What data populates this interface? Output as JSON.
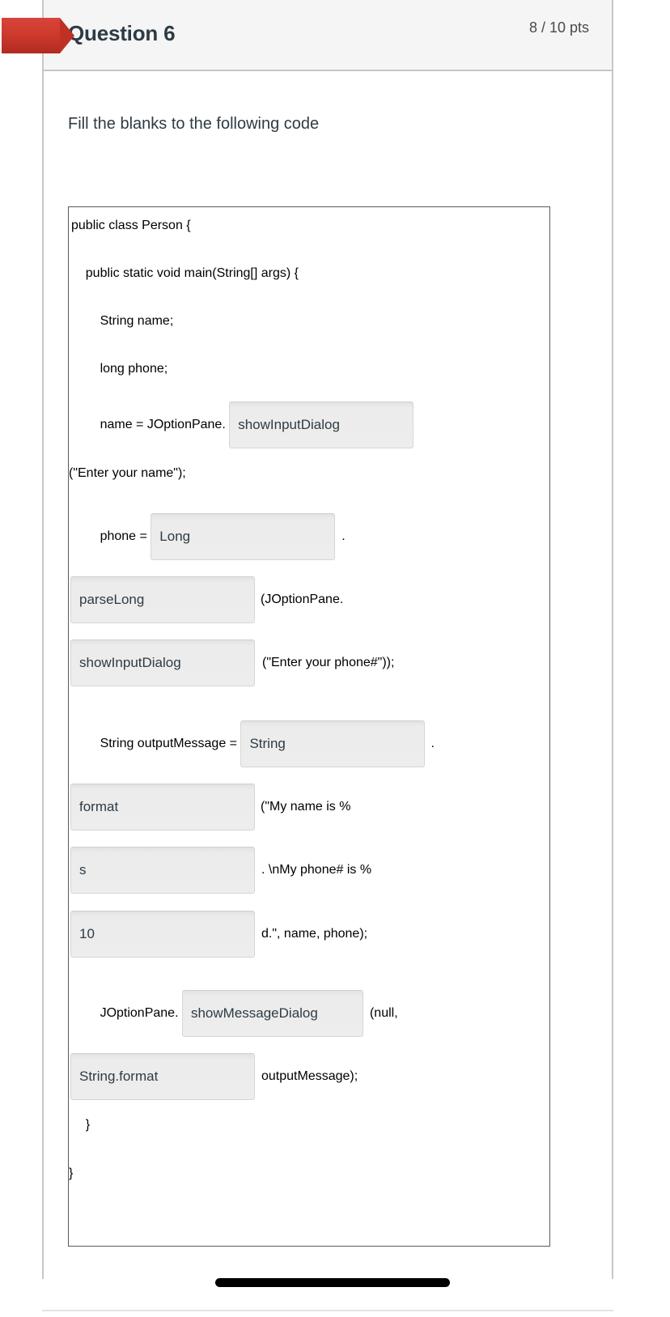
{
  "header": {
    "title": "Question 6",
    "points": "8 / 10 pts",
    "flag_icon": "red-flag-marker"
  },
  "body": {
    "prompt": "Fill the blanks to the following code"
  },
  "code": {
    "lines": [
      {
        "id": "l1",
        "text": "public class Person {"
      },
      {
        "id": "l2",
        "text": "    public static void main(String[] args) {"
      },
      {
        "id": "l3",
        "text": "        String name;"
      },
      {
        "id": "l4",
        "text": "        long phone;"
      },
      {
        "id": "l5",
        "text": "        name = JOptionPane. "
      },
      {
        "id": "l6",
        "text": "(\"Enter your name\");"
      },
      {
        "id": "l7",
        "text": "        phone = "
      },
      {
        "id": "l8",
        "text": "."
      },
      {
        "id": "l9",
        "text": "(JOptionPane."
      },
      {
        "id": "l10",
        "text": "(\"Enter your phone#\"));"
      },
      {
        "id": "l11",
        "text": "        String outputMessage = "
      },
      {
        "id": "l12",
        "text": "."
      },
      {
        "id": "l13",
        "text": "(\"My name is %"
      },
      {
        "id": "l14",
        "text": ". \\nMy phone# is %"
      },
      {
        "id": "l15",
        "text": "d.\", name, phone);"
      },
      {
        "id": "l16",
        "text": "        JOptionPane. "
      },
      {
        "id": "l17",
        "text": "(null,"
      },
      {
        "id": "l18",
        "text": "outputMessage);"
      },
      {
        "id": "l19",
        "text": "    }"
      },
      {
        "id": "l20",
        "text": "}"
      }
    ],
    "blanks": [
      {
        "id": "b1",
        "value": "showInputDialog"
      },
      {
        "id": "b2",
        "value": "Long"
      },
      {
        "id": "b3",
        "value": "parseLong"
      },
      {
        "id": "b4",
        "value": "showInputDialog"
      },
      {
        "id": "b5",
        "value": "String"
      },
      {
        "id": "b6",
        "value": "format"
      },
      {
        "id": "b7",
        "value": "s"
      },
      {
        "id": "b8",
        "value": "10"
      },
      {
        "id": "b9",
        "value": "showMessageDialog"
      },
      {
        "id": "b10",
        "value": "String.format"
      }
    ]
  },
  "scrollbar": {
    "orientation": "horizontal"
  },
  "colors": {
    "flag_red": "#cf3a2e",
    "header_bg": "#f5f5f5",
    "border_gray": "#c7c7c7",
    "text_dark": "#2d3b45",
    "blank_bg": "#ededed",
    "code_border": "#555b5e",
    "scrollbar_thumb": "#000000"
  }
}
